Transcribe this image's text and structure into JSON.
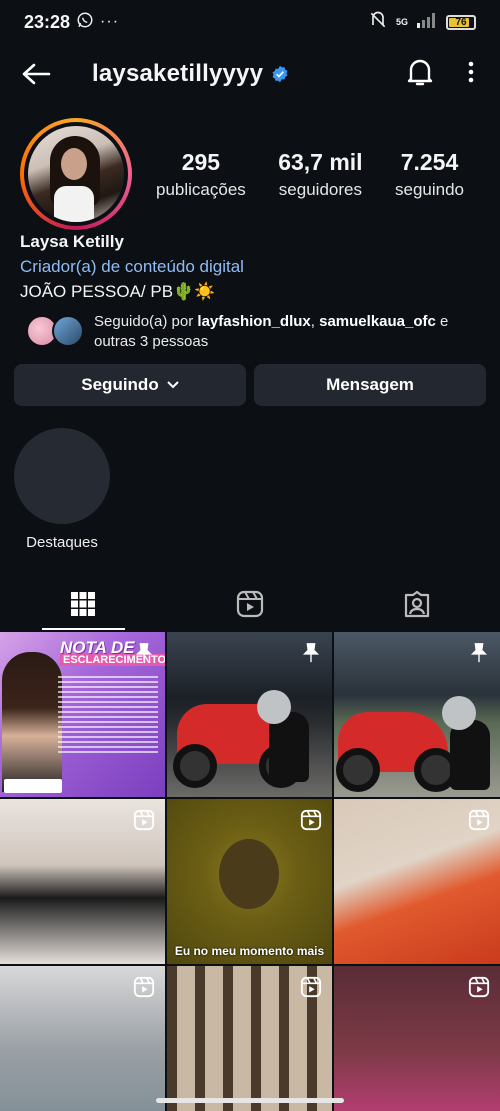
{
  "status_bar": {
    "time": "23:28",
    "network": "5G",
    "battery": "76",
    "battery_level": 0.76
  },
  "header": {
    "username": "laysaketillyyyy",
    "verified": true,
    "icons": [
      "back-arrow-icon",
      "verified-badge-icon",
      "notification-bell-icon",
      "more-options-icon"
    ]
  },
  "stats": [
    {
      "value": "295",
      "label": "publicações"
    },
    {
      "value": "63,7 mil",
      "label": "seguidores"
    },
    {
      "value": "7.254",
      "label": "seguindo"
    }
  ],
  "bio": {
    "name": "Laysa Ketilly",
    "category": "Criador(a) de conteúdo digital",
    "location": "JOÃO PESSOA/ PB🌵☀️"
  },
  "followed_by": {
    "prefix": "Seguido(a) por",
    "users": [
      "layfashion_dlux",
      "samuelkaua_ofc"
    ],
    "separator": ",",
    "conjunction": "e",
    "others": "outras 3 pessoas"
  },
  "buttons": {
    "following": "Seguindo",
    "message": "Mensagem"
  },
  "highlight": {
    "label": "Destaques"
  },
  "tabs": [
    "grid-icon",
    "reels-icon",
    "tagged-icon"
  ],
  "posts": [
    {
      "type": "pinned",
      "title": "NOTA DE",
      "subtitle": "ESCLARECIMENTO!"
    },
    {
      "type": "pinned"
    },
    {
      "type": "pinned"
    },
    {
      "type": "reel"
    },
    {
      "type": "reel",
      "caption": "Eu no meu momento mais"
    },
    {
      "type": "reel"
    },
    {
      "type": "reel"
    },
    {
      "type": "reel"
    },
    {
      "type": "reel"
    }
  ],
  "colors": {
    "background": "#0c0f14",
    "link_blue": "#8fbcf5",
    "verified_blue": "#3897f0",
    "button_bg": "#232830"
  }
}
